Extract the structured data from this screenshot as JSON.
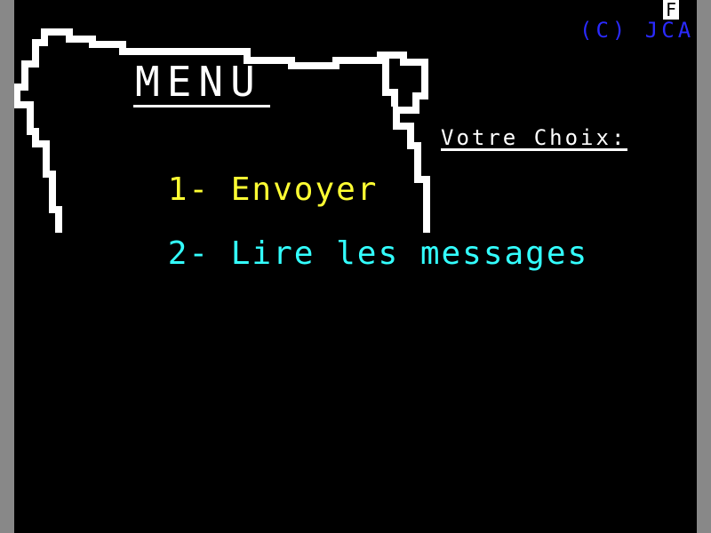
{
  "header": {
    "copyright": "(C) JCA",
    "status_flag": "F"
  },
  "menu": {
    "title": "MENU",
    "items": [
      {
        "number": "1-",
        "label": "Envoyer",
        "color": "#ffff33"
      },
      {
        "number": "2-",
        "label": "Lire les messages",
        "color": "#33ffff"
      }
    ]
  },
  "prompt": {
    "label": "Votre Choix:",
    "value": ""
  },
  "colors": {
    "background": "#000000",
    "border": "#ffffff",
    "copyright": "#2a2aff",
    "item_1": "#ffff33",
    "item_2": "#33ffff"
  }
}
